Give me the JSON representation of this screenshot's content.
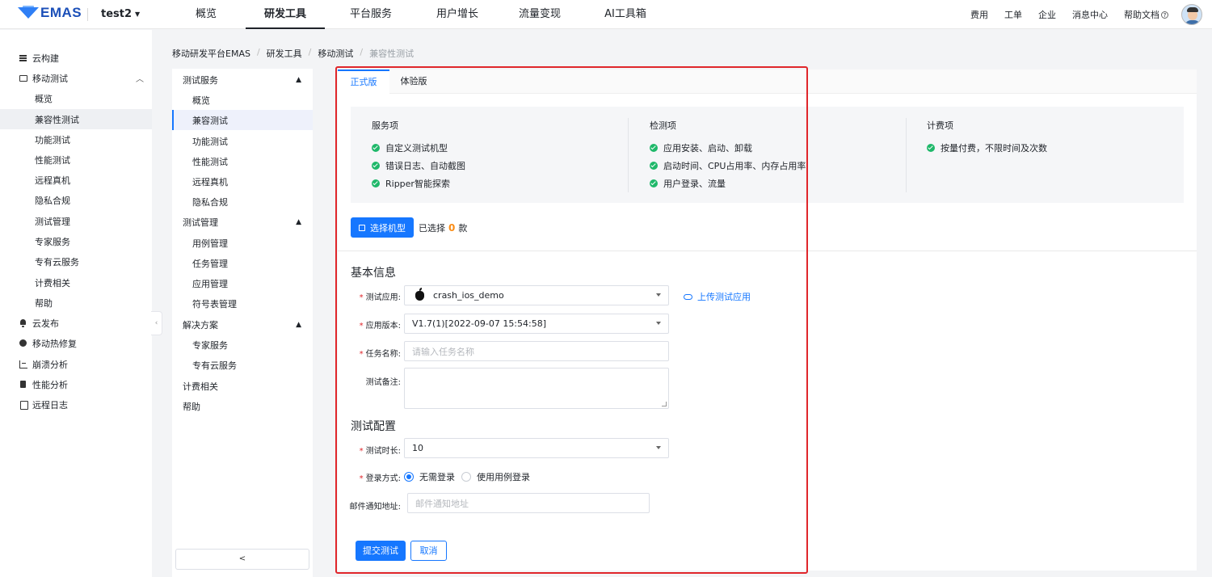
{
  "topnav": {
    "logo": "EMAS",
    "project": "test2",
    "menu": [
      "概览",
      "研发工具",
      "平台服务",
      "用户增长",
      "流量变现",
      "AI工具箱"
    ],
    "active_menu": "研发工具",
    "right_links": [
      "费用",
      "工单",
      "企业",
      "消息中心",
      "帮助文档"
    ]
  },
  "sidebar": {
    "items": [
      {
        "label": "云构建",
        "icon": "list-icon"
      },
      {
        "label": "移动测试",
        "icon": "monitor-icon",
        "expanded": true
      },
      {
        "label": "概览"
      },
      {
        "label": "兼容性测试",
        "active": true
      },
      {
        "label": "功能测试"
      },
      {
        "label": "性能测试"
      },
      {
        "label": "远程真机"
      },
      {
        "label": "隐私合规"
      },
      {
        "label": "测试管理"
      },
      {
        "label": "专家服务"
      },
      {
        "label": "专有云服务"
      },
      {
        "label": "计费相关"
      },
      {
        "label": "帮助"
      },
      {
        "label": "云发布",
        "icon": "bell-icon"
      },
      {
        "label": "移动热修复",
        "icon": "circle-icon"
      },
      {
        "label": "崩溃分析",
        "icon": "chart-icon"
      },
      {
        "label": "性能分析",
        "icon": "doc-icon"
      },
      {
        "label": "远程日志",
        "icon": "log-icon"
      }
    ]
  },
  "breadcrumb": [
    "移动研发平台EMAS",
    "研发工具",
    "移动测试",
    "兼容性测试"
  ],
  "subnav": {
    "items": [
      {
        "label": "测试服务",
        "type": "group"
      },
      {
        "label": "概览",
        "type": "child"
      },
      {
        "label": "兼容测试",
        "type": "child",
        "active": true
      },
      {
        "label": "功能测试",
        "type": "child"
      },
      {
        "label": "性能测试",
        "type": "child"
      },
      {
        "label": "远程真机",
        "type": "child"
      },
      {
        "label": "隐私合规",
        "type": "child"
      },
      {
        "label": "测试管理",
        "type": "group"
      },
      {
        "label": "用例管理",
        "type": "child"
      },
      {
        "label": "任务管理",
        "type": "child"
      },
      {
        "label": "应用管理",
        "type": "child"
      },
      {
        "label": "符号表管理",
        "type": "child"
      },
      {
        "label": "解决方案",
        "type": "group"
      },
      {
        "label": "专家服务",
        "type": "child"
      },
      {
        "label": "专有云服务",
        "type": "child"
      },
      {
        "label": "计费相关",
        "type": "plain"
      },
      {
        "label": "帮助",
        "type": "plain"
      }
    ],
    "collapse": "<"
  },
  "tabs": [
    "正式版",
    "体验版"
  ],
  "info": {
    "service_title": "服务项",
    "service_items": [
      "自定义测试机型",
      "错误日志、自动截图",
      "Ripper智能探索"
    ],
    "check_title": "检测项",
    "check_items": [
      "应用安装、启动、卸载",
      "启动时间、CPU占用率、内存占用率",
      "用户登录、流量"
    ],
    "billing_title": "计费项",
    "billing_items": [
      "按量付费，不限时间及次数"
    ]
  },
  "select_model": {
    "button": "选择机型",
    "selected_prefix": "已选择",
    "count": "0",
    "unit": "款"
  },
  "basic": {
    "title": "基本信息",
    "app_label": "测试应用:",
    "app_value": "crash_ios_demo",
    "upload": "上传测试应用",
    "version_label": "应用版本:",
    "version_value": "V1.7(1)[2022-09-07 15:54:58]",
    "task_label": "任务名称:",
    "task_placeholder": "请输入任务名称",
    "remark_label": "测试备注:"
  },
  "config": {
    "title": "测试配置",
    "duration_label": "测试时长:",
    "duration_value": "10",
    "login_label": "登录方式:",
    "login_options": [
      "无需登录",
      "使用用例登录"
    ],
    "login_selected": "无需登录",
    "email_label": "邮件通知地址:",
    "email_placeholder": "邮件通知地址"
  },
  "actions": {
    "submit": "提交测试",
    "cancel": "取消"
  },
  "colors": {
    "accent": "#1677ff",
    "highlight": "#e0262b",
    "success": "#1fb86a",
    "count": "#fa8c16"
  }
}
